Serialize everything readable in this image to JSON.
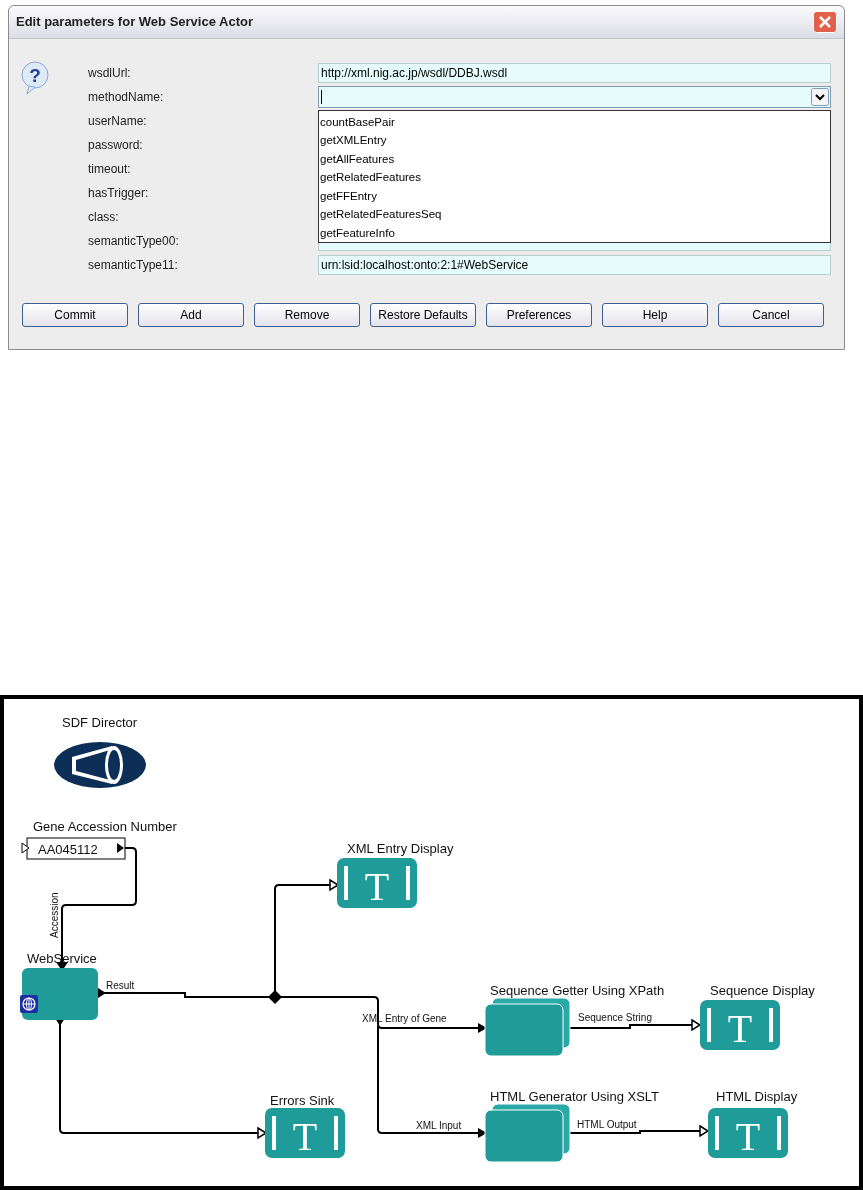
{
  "dialog": {
    "title": "Edit parameters for Web Service Actor",
    "icon_glyph": "?",
    "params": [
      {
        "label": "wsdlUrl:",
        "kind": "text",
        "value": "http://xml.nig.ac.jp/wsdl/DDBJ.wsdl"
      },
      {
        "label": "methodName:",
        "kind": "combo"
      },
      {
        "label": "userName:",
        "kind": "covered"
      },
      {
        "label": "password:",
        "kind": "covered"
      },
      {
        "label": "timeout:",
        "kind": "covered"
      },
      {
        "label": "hasTrigger:",
        "kind": "covered"
      },
      {
        "label": "class:",
        "kind": "covered"
      },
      {
        "label": "semanticType00:",
        "kind": "text"
      },
      {
        "label": "semanticType11:",
        "kind": "text",
        "value": "urn:lsid:localhost:onto:2:1#WebService"
      }
    ],
    "options": [
      "countBasePair",
      "getXMLEntry",
      "getAllFeatures",
      "getRelatedFeatures",
      "getFFEntry",
      "getRelatedFeaturesSeq",
      "getFeatureInfo"
    ],
    "buttons": [
      "Commit",
      "Add",
      "Remove",
      "Restore Defaults",
      "Preferences",
      "Help",
      "Cancel"
    ]
  },
  "workflow": {
    "director": {
      "label": "SDF Director"
    },
    "parameter": {
      "label": "Gene Accession Number",
      "value": "AA045112"
    },
    "actors": [
      {
        "kind": "display",
        "label": "XML Entry Display",
        "glyph": "T"
      },
      {
        "kind": "webservice",
        "label": "WebService"
      },
      {
        "kind": "composite",
        "label": "Sequence Getter Using XPath"
      },
      {
        "kind": "display",
        "label": "Sequence Display",
        "glyph": "T"
      },
      {
        "kind": "display",
        "label": "Errors Sink",
        "glyph": "T"
      },
      {
        "kind": "composite",
        "label": "HTML Generator Using XSLT"
      },
      {
        "kind": "display",
        "label": "HTML Display",
        "glyph": "T"
      }
    ],
    "port_labels": [
      "Accession",
      "Result",
      "XML Entry of Gene",
      "Sequence String",
      "XML Input",
      "HTML Output"
    ]
  }
}
